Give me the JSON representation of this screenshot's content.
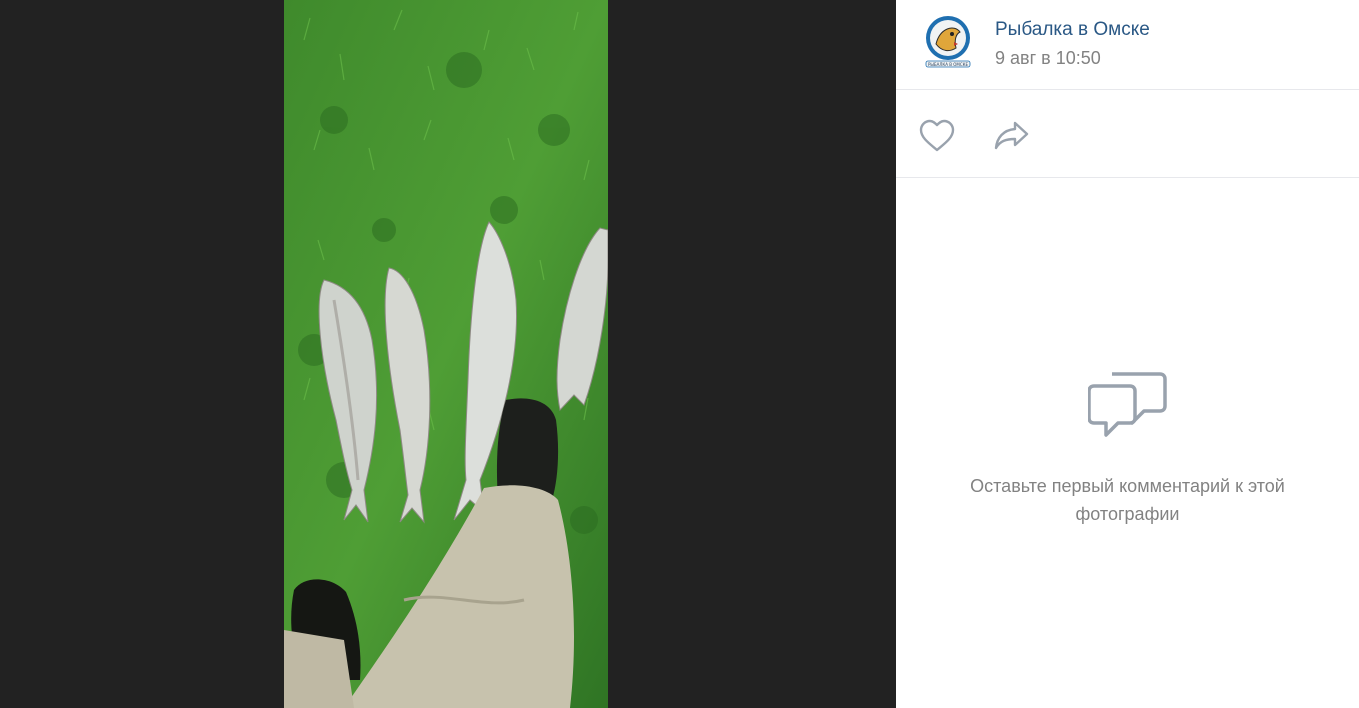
{
  "post": {
    "author": "Рыбалка в Омске",
    "date": "9 авг в 10:50"
  },
  "avatar": {
    "caption": "РЫБАЛКА В ОМСКЕ"
  },
  "actions": {
    "like_icon": "heart-icon",
    "share_icon": "share-arrow-icon"
  },
  "comments": {
    "empty_icon": "comments-icon",
    "empty_text": "Оставьте первый комментарий к этой фотографии"
  },
  "colors": {
    "author_link": "#2a5885",
    "muted_text": "#828282",
    "viewer_bg": "#222222",
    "icon_gray": "#99a2ad"
  }
}
